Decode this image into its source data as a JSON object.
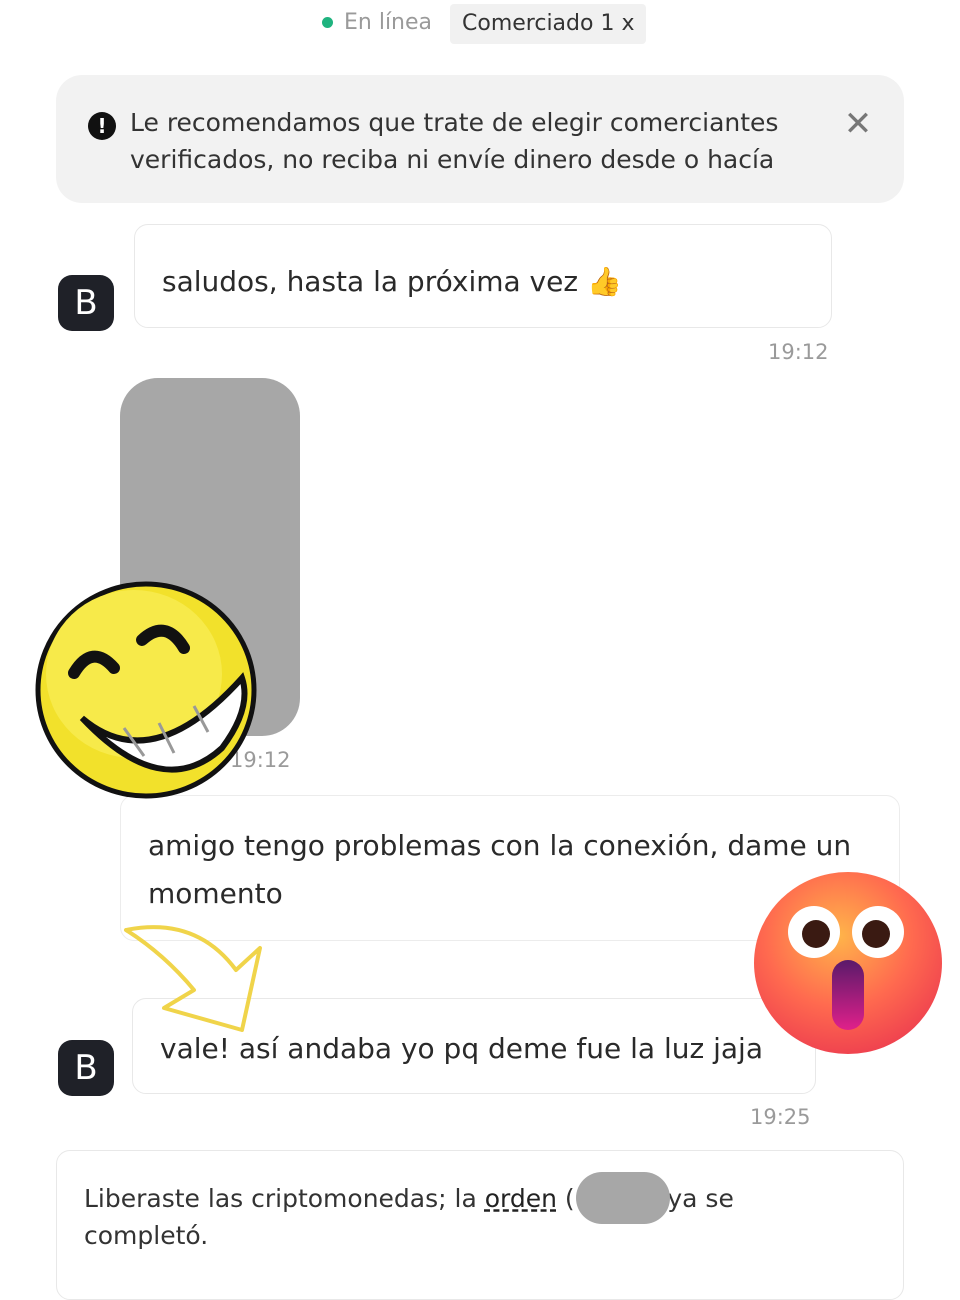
{
  "header": {
    "status": "En línea",
    "traded": "Comerciado 1 x"
  },
  "warning": {
    "icon": "exclamation-icon",
    "text": "Le recomendamos que trate de elegir comerciantes verificados, no reciba ni envíe dinero desde o hacía",
    "close": "✕"
  },
  "messages": [
    {
      "avatar": "B",
      "text": "saludos, hasta la próxima vez 👍",
      "time": "19:12"
    },
    {
      "time": "19:12"
    },
    {
      "text": "amigo tengo problemas con la conexión,  dame un momento"
    },
    {
      "avatar": "B",
      "text": "vale! así andaba yo pq deme fue la luz jaja",
      "time": "19:25"
    }
  ],
  "system": {
    "prefix": "Liberaste las criptomonedas; la ",
    "link": "orden",
    "suffix_a": " (",
    "suffix_b": ") ya se completó."
  },
  "colors": {
    "online": "#1fb37f",
    "avatar": "#1f2128",
    "redaction": "#a7a7a7"
  }
}
